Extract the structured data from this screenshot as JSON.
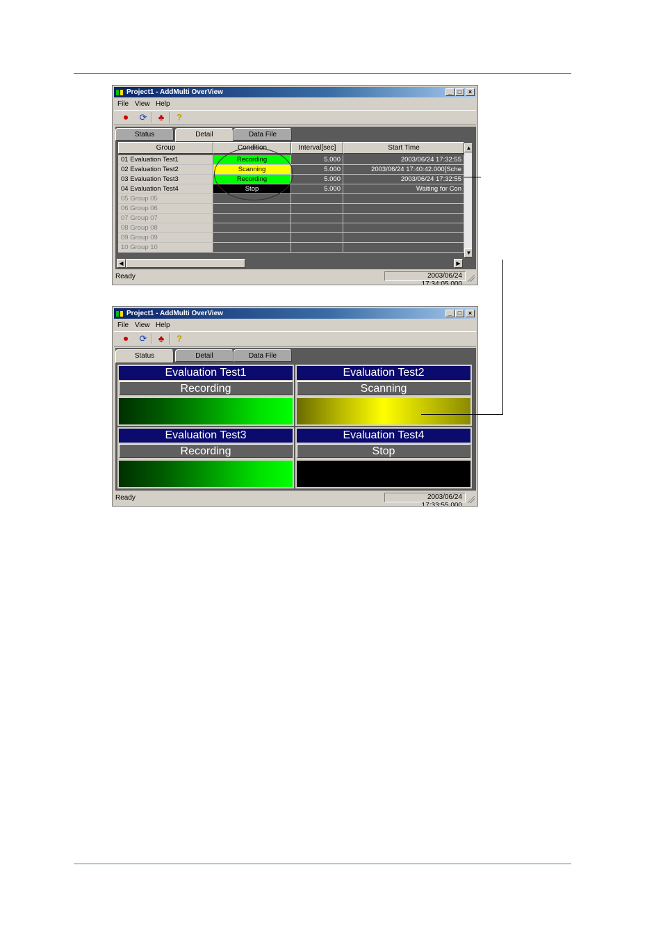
{
  "window1": {
    "title": "Project1 - AddMulti OverView",
    "menu": [
      "File",
      "View",
      "Help"
    ],
    "tabs": [
      "Status",
      "Detail",
      "Data File"
    ],
    "active_tab": "Detail",
    "columns": [
      "Group",
      "Condition",
      "Interval[sec]",
      "Start Time"
    ],
    "rows": [
      {
        "group": "01 Evaluation Test1",
        "condition": "Recording",
        "interval": "5.000",
        "start": "2003/06/24 17:32:55"
      },
      {
        "group": "02 Evaluation Test2",
        "condition": "Scanning",
        "interval": "5.000",
        "start": "2003/06/24 17:40:42.000[Sche"
      },
      {
        "group": "03 Evaluation Test3",
        "condition": "Recording",
        "interval": "5.000",
        "start": "2003/06/24 17:32:55"
      },
      {
        "group": "04 Evaluation Test4",
        "condition": "Stop",
        "interval": "5.000",
        "start": "Waiting for Con"
      },
      {
        "group": "05 Group 05",
        "condition": "",
        "interval": "",
        "start": ""
      },
      {
        "group": "06 Group 06",
        "condition": "",
        "interval": "",
        "start": ""
      },
      {
        "group": "07 Group 07",
        "condition": "",
        "interval": "",
        "start": ""
      },
      {
        "group": "08 Group 08",
        "condition": "",
        "interval": "",
        "start": ""
      },
      {
        "group": "09 Group 09",
        "condition": "",
        "interval": "",
        "start": ""
      },
      {
        "group": "10 Group 10",
        "condition": "",
        "interval": "",
        "start": ""
      }
    ],
    "status_text": "Ready",
    "status_time": "2003/06/24 17:34:05.000"
  },
  "window2": {
    "title": "Project1 - AddMulti OverView",
    "menu": [
      "File",
      "View",
      "Help"
    ],
    "tabs": [
      "Status",
      "Detail",
      "Data File"
    ],
    "active_tab": "Status",
    "panels": [
      {
        "name": "Evaluation Test1",
        "state": "Recording",
        "bar": "green"
      },
      {
        "name": "Evaluation Test2",
        "state": "Scanning",
        "bar": "yellow"
      },
      {
        "name": "Evaluation Test3",
        "state": "Recording",
        "bar": "green"
      },
      {
        "name": "Evaluation Test4",
        "state": "Stop",
        "bar": "black"
      }
    ],
    "status_text": "Ready",
    "status_time": "2003/06/24 17:33:55.000"
  },
  "toolbar_icons": [
    "stop-record-icon",
    "refresh-icon",
    "alarm-icon",
    "help-icon"
  ],
  "colors": {
    "recording": "#00ff00",
    "scanning": "#ffff00",
    "stop": "#000000",
    "title": "#0b0b6e"
  }
}
